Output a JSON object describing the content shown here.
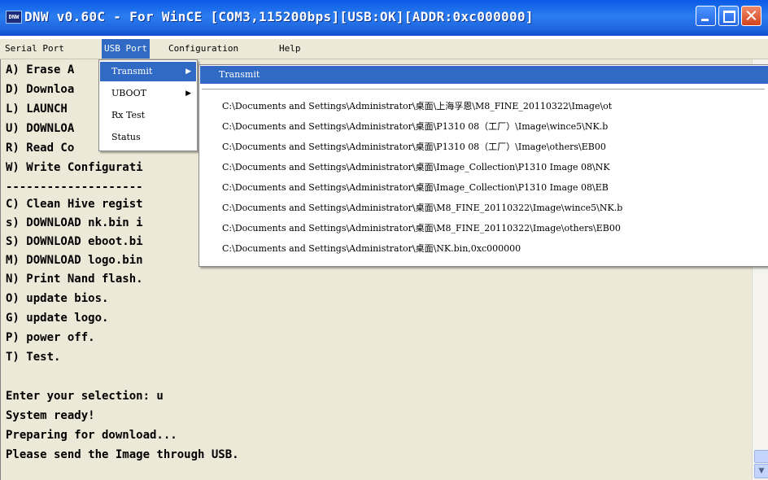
{
  "window": {
    "icon_text": "DNW",
    "title": "DNW v0.60C - For WinCE   [COM3,115200bps][USB:OK][ADDR:0xc000000]"
  },
  "menubar": {
    "items": [
      "Serial Port",
      "USB Port",
      "Configuration",
      "Help"
    ]
  },
  "usb_menu": {
    "items": [
      {
        "label": "Transmit",
        "arrow": "▶"
      },
      {
        "label": "UBOOT",
        "arrow": "▶"
      },
      {
        "label": "Rx Test",
        "arrow": ""
      },
      {
        "label": "Status",
        "arrow": ""
      }
    ]
  },
  "transmit_menu": {
    "header": "Transmit",
    "recent_files": [
      "C:\\Documents and Settings\\Administrator\\桌面\\上海孚恩\\M8_FINE_20110322\\Image\\ot",
      "C:\\Documents and Settings\\Administrator\\桌面\\P1310 08（工厂）\\Image\\wince5\\NK.b",
      "C:\\Documents and Settings\\Administrator\\桌面\\P1310 08（工厂）\\Image\\others\\EB00",
      "C:\\Documents and Settings\\Administrator\\桌面\\Image_Collection\\P1310 Image 08\\NK",
      "C:\\Documents and Settings\\Administrator\\桌面\\Image_Collection\\P1310 Image 08\\EB",
      "C:\\Documents and Settings\\Administrator\\桌面\\M8_FINE_20110322\\Image\\wince5\\NK.b",
      "C:\\Documents and Settings\\Administrator\\桌面\\M8_FINE_20110322\\Image\\others\\EB00",
      "C:\\Documents and Settings\\Administrator\\桌面\\NK.bin,0xc000000"
    ]
  },
  "console": {
    "lines": [
      "A) Erase A",
      "D) Downloa",
      "L) LAUNCH",
      "U) DOWNLOA",
      "R) Read Co",
      "W) Write Configurati",
      "--------------------",
      "C) Clean Hive regist",
      "s) DOWNLOAD nk.bin i",
      "S) DOWNLOAD eboot.bi",
      "M) DOWNLOAD logo.bin",
      "N) Print Nand flash.",
      "O) update bios.",
      "G) update logo.",
      "P) power off.",
      "T) Test.",
      "",
      "Enter your selection: u",
      "System ready!",
      "Preparing for download...",
      "Please send the Image through USB."
    ]
  }
}
